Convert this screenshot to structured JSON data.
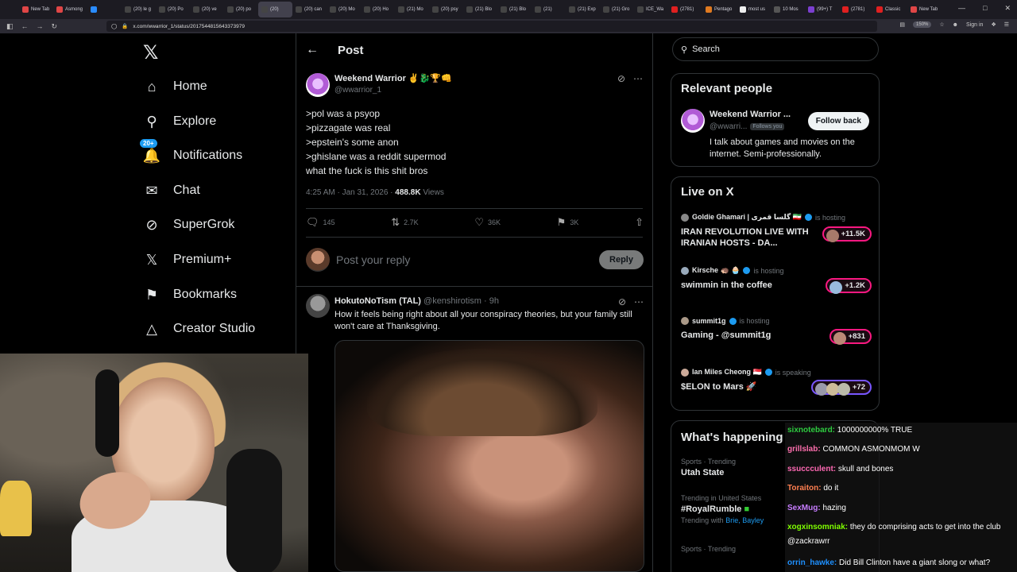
{
  "browser": {
    "tabs": [
      {
        "label": "New Tab",
        "color": "#e04646"
      },
      {
        "label": "Asmong",
        "color": "#e04646"
      },
      {
        "label": "",
        "color": "#2a8cff"
      },
      {
        "label": "(20) le g",
        "color": "#444"
      },
      {
        "label": "(20) Po",
        "color": "#444"
      },
      {
        "label": "(20) ve",
        "color": "#444"
      },
      {
        "label": "(20) po",
        "color": "#444"
      },
      {
        "label": "(20)",
        "color": "#444"
      },
      {
        "label": "(20) can",
        "color": "#444"
      },
      {
        "label": "(20) Mo",
        "color": "#444"
      },
      {
        "label": "(20) Ho",
        "color": "#444"
      },
      {
        "label": "(21) Mo",
        "color": "#444"
      },
      {
        "label": "(20) psy",
        "color": "#444"
      },
      {
        "label": "(21) Blo",
        "color": "#444"
      },
      {
        "label": "(21) Blo",
        "color": "#444"
      },
      {
        "label": "(21)",
        "color": "#444"
      },
      {
        "label": "(21) Exp",
        "color": "#444"
      },
      {
        "label": "(21) Gro",
        "color": "#444"
      },
      {
        "label": "ICE_Wa",
        "color": "#444"
      },
      {
        "label": "(2781)",
        "color": "#e02020"
      },
      {
        "label": "Pentago",
        "color": "#e07a20"
      },
      {
        "label": "most us",
        "color": "#eee"
      },
      {
        "label": "10 Mos",
        "color": "#555"
      },
      {
        "label": "(99+) T",
        "color": "#7b3fd0"
      },
      {
        "label": "(2781)",
        "color": "#e02020"
      },
      {
        "label": "Classic",
        "color": "#e02020"
      },
      {
        "label": "New Tab",
        "color": "#e04646"
      }
    ],
    "url": "x.com/wwarrior_1/status/2017544815643373979",
    "zoom": "150%",
    "sign_in": "Sign in"
  },
  "nav": {
    "items": [
      {
        "label": "Home",
        "icon": "home-icon"
      },
      {
        "label": "Explore",
        "icon": "search-icon"
      },
      {
        "label": "Notifications",
        "icon": "bell-icon",
        "badge": "20+"
      },
      {
        "label": "Chat",
        "icon": "mail-icon"
      },
      {
        "label": "SuperGrok",
        "icon": "grok-icon"
      },
      {
        "label": "Premium+",
        "icon": "x-premium-icon"
      },
      {
        "label": "Bookmarks",
        "icon": "bookmark-icon"
      },
      {
        "label": "Creator Studio",
        "icon": "creator-icon"
      }
    ]
  },
  "post": {
    "header": "Post",
    "author_name": "Weekend Warrior ✌️🐉🏆👊",
    "author_handle": "@wwarrior_1",
    "lines": [
      ">pol was a psyop",
      ">pizzagate was real",
      ">epstein's some anon",
      ">ghislane was a reddit supermod",
      "what the fuck is this shit bros"
    ],
    "time": "4:25 AM · Jan 31, 2026 · ",
    "views_count": "488.8K",
    "views_label": " Views",
    "stats": {
      "replies": "145",
      "reposts": "2.7K",
      "likes": "36K",
      "bookmarks": "3K"
    },
    "reply_placeholder": "Post your reply",
    "reply_button": "Reply"
  },
  "reply": {
    "name": "HokutoNoTism (TAL)",
    "handle": " @kenshirotism · 9h",
    "text": "How it feels being right about all your conspiracy theories, but your family still won't care at Thanksgiving."
  },
  "sidebar": {
    "search_placeholder": "Search",
    "relevant_title": "Relevant people",
    "relevant": {
      "name": "Weekend Warrior ...",
      "handle": "@wwarri...",
      "follows_you": "Follows you",
      "follow_btn": "Follow back",
      "bio": "I talk about games and movies on the internet. Semi-professionally."
    },
    "live_title": "Live on X",
    "live": [
      {
        "host": "Goldie Ghamari | گلسا قمری 🇮🇷",
        "status": "is hosting",
        "title": "IRAN REVOLUTION LIVE WITH IRANIAN HOSTS - DA...",
        "count": "+11.5K",
        "pill_color": "#f91880"
      },
      {
        "host": "Kirsche 🦔 🧁",
        "status": "is hosting",
        "title": "swimmin in the coffee",
        "count": "+1.2K",
        "pill_color": "#f91880"
      },
      {
        "host": "summit1g",
        "status": "is hosting",
        "title": "Gaming - @summit1g",
        "count": "+831",
        "pill_color": "#f91880"
      },
      {
        "host": "Ian Miles Cheong 🇸🇬",
        "status": "is speaking",
        "title": "$ELON to Mars 🚀",
        "count": "+72",
        "pill_color": "#7856ff"
      }
    ],
    "happening_title": "What's happening",
    "trends": [
      {
        "category": "Sports · Trending",
        "name": "Utah State",
        "sub": "",
        "with": ""
      },
      {
        "category": "Trending in United States",
        "name": "#RoyalRumble",
        "sub": "Trending with ",
        "with": "Brie, Bayley"
      },
      {
        "category": "Sports · Trending",
        "name": "",
        "sub": "",
        "with": ""
      }
    ]
  },
  "chat": {
    "messages": [
      {
        "user": "sixnotebard:",
        "color": "#2ecc40",
        "text": " 1000000000% TRUE"
      },
      {
        "user": "grillslab:",
        "color": "#ff6fae",
        "text": " COMMON ASMONMOM W"
      },
      {
        "user": "ssuccculent:",
        "color": "#ff69b4",
        "text": " skull and bones"
      },
      {
        "user": "Toraiton:",
        "color": "#ff7f50",
        "text": " do it"
      },
      {
        "user": "SexMug:",
        "color": "#c77dff",
        "text": " hazing"
      },
      {
        "user": "xogxinsomniak:",
        "color": "#7fff00",
        "text": " they do comprising acts to get into the club @zackrawrr"
      },
      {
        "user": "orrin_hawke:",
        "color": "#1e90ff",
        "text": " Did Bill Clinton have a giant slong or what?"
      }
    ]
  }
}
